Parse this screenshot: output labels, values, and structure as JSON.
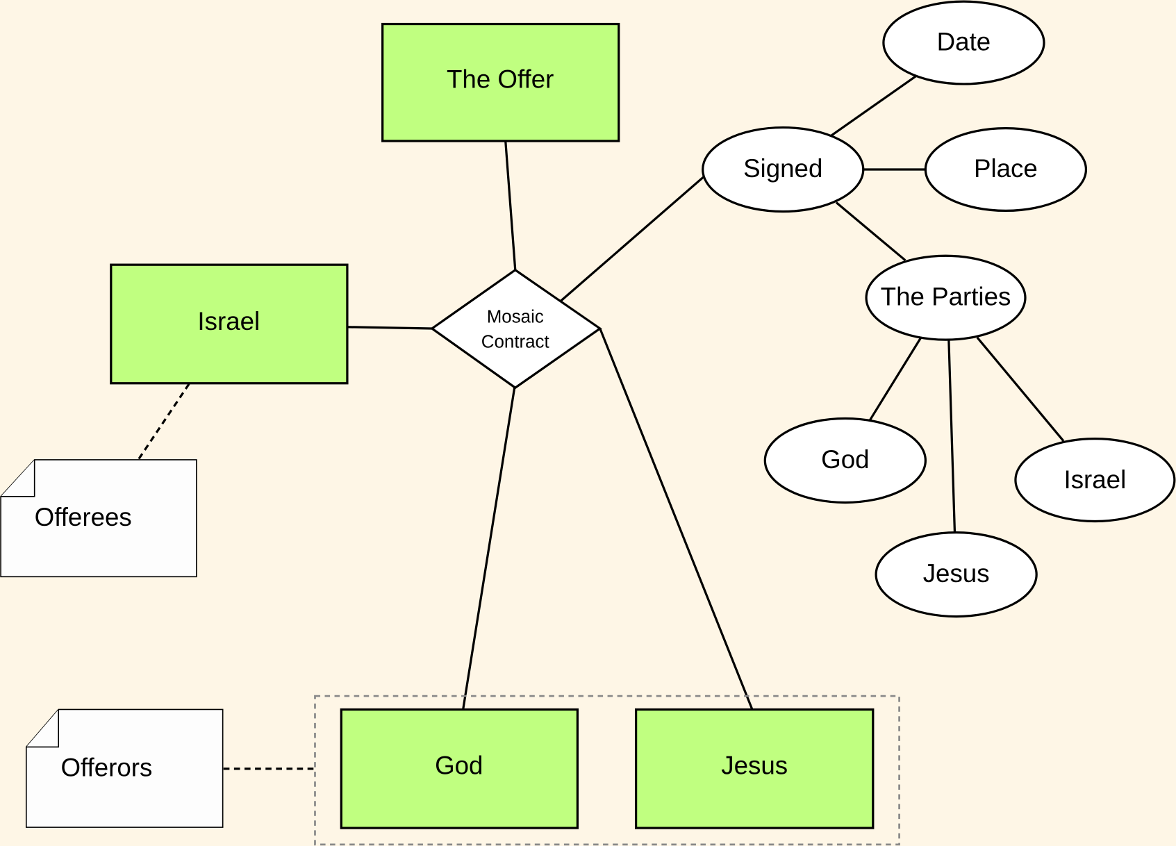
{
  "diagram": {
    "type": "entity-relationship",
    "background": "#fef6e6",
    "colors": {
      "entity_fill": "#c0ff80",
      "attribute_fill": "#ffffff",
      "note_fill": "#fdfdfd",
      "group_border": "#888888"
    },
    "relationship": {
      "label_line1": "Mosaic",
      "label_line2": "Contract"
    },
    "entities": {
      "offer": "The Offer",
      "israel": "Israel",
      "god": "God",
      "jesus": "Jesus"
    },
    "attributes": {
      "signed": "Signed",
      "date": "Date",
      "place": "Place",
      "parties": "The Parties",
      "party_god": "God",
      "party_jesus": "Jesus",
      "party_israel": "Israel"
    },
    "notes": {
      "offerees": "Offerees",
      "offerors": "Offerors"
    }
  }
}
